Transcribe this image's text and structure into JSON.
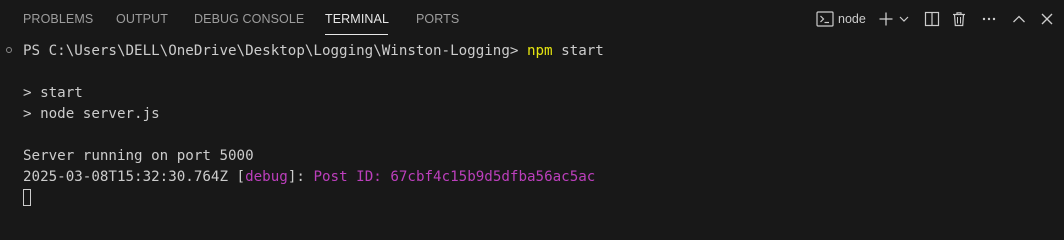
{
  "tabs": {
    "problems": "PROBLEMS",
    "output": "OUTPUT",
    "debug_console": "DEBUG CONSOLE",
    "terminal": "TERMINAL",
    "ports": "PORTS",
    "active": "TERMINAL"
  },
  "actions": {
    "terminal_name": "node",
    "icons": [
      "terminal-icon",
      "plus-icon",
      "chevron-down-icon",
      "split-terminal-icon",
      "trash-icon",
      "more-icon",
      "maximize-panel-icon",
      "close-icon"
    ]
  },
  "terminal": {
    "prompt": "PS C:\\Users\\DELL\\OneDrive\\Desktop\\Logging\\Winston-Logging>",
    "command": "npm",
    "command_args": "start",
    "script_line": "> start",
    "node_line": "> node server.js",
    "server_line": "Server running on port 5000",
    "log_timestamp": "2025-03-08T15:32:30.764Z",
    "log_level_open": "[",
    "log_level": "debug",
    "log_level_close": "]:",
    "log_message": "Post ID: 67cbf4c15b9d5dfba56ac5ac"
  },
  "colors": {
    "background": "#181818",
    "text": "#cccccc",
    "command": "#e5e510",
    "debug": "#bc3fbc",
    "tab_inactive": "#9d9d9d",
    "tab_active": "#e7e7e7"
  }
}
